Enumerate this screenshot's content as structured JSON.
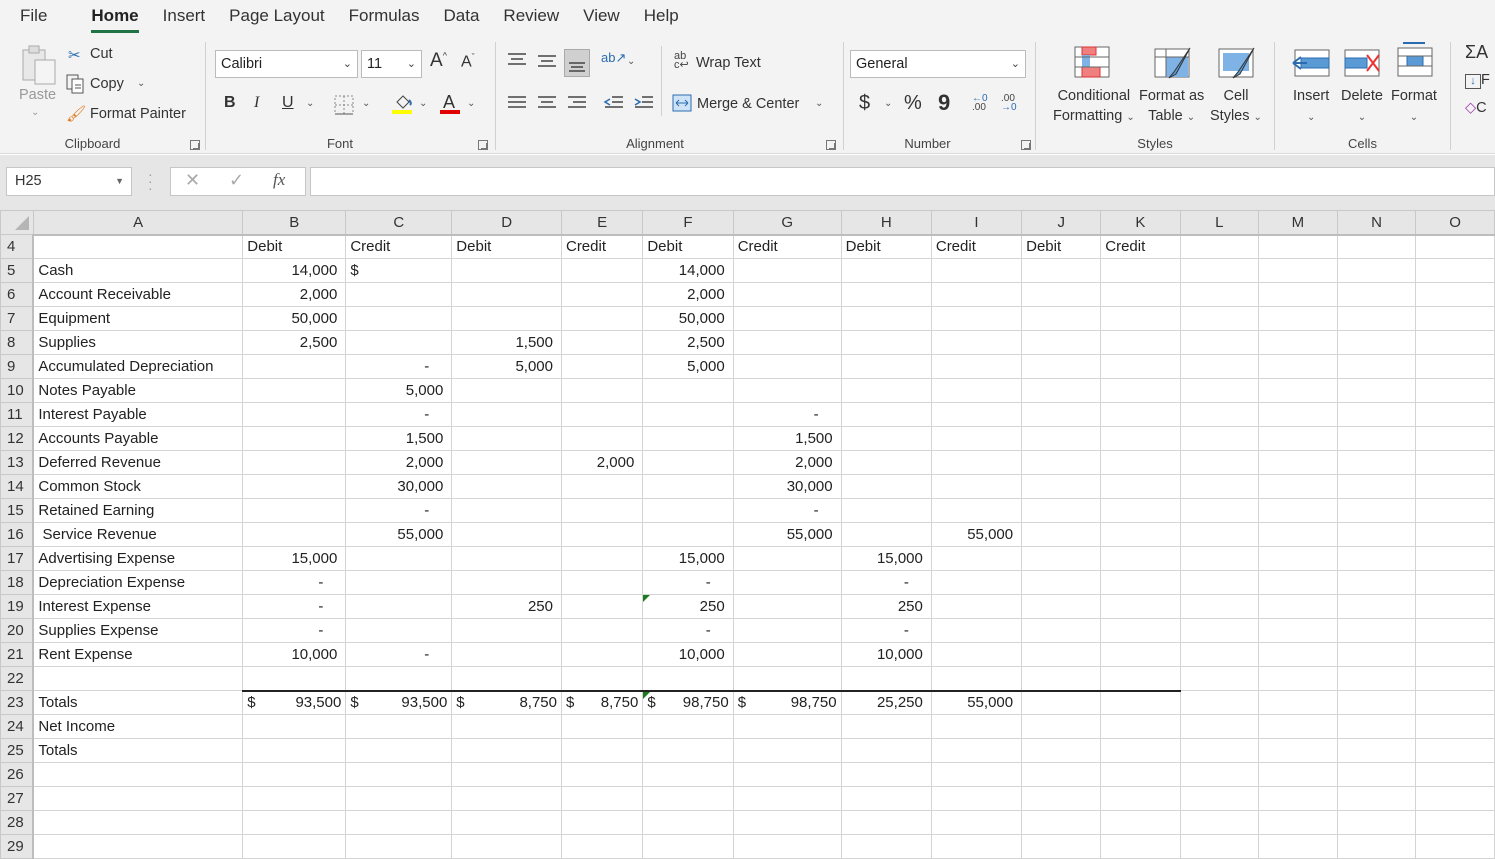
{
  "menu": [
    "File",
    "Home",
    "Insert",
    "Page Layout",
    "Formulas",
    "Data",
    "Review",
    "View",
    "Help"
  ],
  "active_menu": "Home",
  "ribbon": {
    "clipboard": {
      "label": "Clipboard",
      "paste": "Paste",
      "cut": "Cut",
      "copy": "Copy",
      "format_painter": "Format Painter"
    },
    "font": {
      "label": "Font",
      "font_name": "Calibri",
      "font_size": "11",
      "bold": "B",
      "italic": "I",
      "underline": "U",
      "highlight_color": "#ffff00",
      "font_color": "#ff0000"
    },
    "alignment": {
      "label": "Alignment",
      "wrap_text": "Wrap Text",
      "merge_center": "Merge & Center"
    },
    "number": {
      "label": "Number",
      "format": "General",
      "currency": "$",
      "percent": "%",
      "comma": "9"
    },
    "styles": {
      "label": "Styles",
      "conditional": "Conditional",
      "conditional2": "Formatting",
      "format_as": "Format as",
      "format_as2": "Table",
      "cell": "Cell",
      "cell2": "Styles"
    },
    "cells": {
      "label": "Cells",
      "insert": "Insert",
      "delete": "Delete",
      "format": "Format"
    },
    "editing": {
      "autosum": "A",
      "fill": "F",
      "clear": "C"
    }
  },
  "formula_bar": {
    "name_box": "H25",
    "cancel": "✕",
    "enter": "✓",
    "fx": "fx",
    "value": ""
  },
  "columns": [
    "A",
    "B",
    "C",
    "D",
    "E",
    "F",
    "G",
    "H",
    "I",
    "J",
    "K",
    "L",
    "M",
    "N",
    "O"
  ],
  "rows": [
    {
      "n": "4",
      "cells": [
        "",
        "Debit",
        "Credit",
        "Debit",
        "Credit",
        "Debit",
        "Credit",
        "Debit",
        "Credit",
        "Debit",
        "Credit",
        "",
        "",
        "",
        ""
      ]
    },
    {
      "n": "5",
      "cells": [
        "Cash",
        "14,000",
        "$",
        "",
        "",
        "14,000",
        "",
        "",
        "",
        "",
        "",
        "",
        "",
        "",
        ""
      ]
    },
    {
      "n": "6",
      "cells": [
        "Account Receivable",
        "2,000",
        "",
        "",
        "",
        "2,000",
        "",
        "",
        "",
        "",
        "",
        "",
        "",
        "",
        ""
      ]
    },
    {
      "n": "7",
      "cells": [
        "Equipment",
        "50,000",
        "",
        "",
        "",
        "50,000",
        "",
        "",
        "",
        "",
        "",
        "",
        "",
        "",
        ""
      ]
    },
    {
      "n": "8",
      "cells": [
        "Supplies",
        "2,500",
        "",
        "1,500",
        "",
        "2,500",
        "",
        "",
        "",
        "",
        "",
        "",
        "",
        "",
        ""
      ]
    },
    {
      "n": "9",
      "cells": [
        "Accumulated Depreciation",
        "",
        "-",
        "5,000",
        "",
        "5,000",
        "",
        "",
        "",
        "",
        "",
        "",
        "",
        "",
        ""
      ]
    },
    {
      "n": "10",
      "cells": [
        "Notes Payable",
        "",
        "5,000",
        "",
        "",
        "",
        "",
        "",
        "",
        "",
        "",
        "",
        "",
        "",
        ""
      ]
    },
    {
      "n": "11",
      "cells": [
        "Interest Payable",
        "",
        "-",
        "",
        "",
        "",
        "-",
        "",
        "",
        "",
        "",
        "",
        "",
        "",
        ""
      ]
    },
    {
      "n": "12",
      "cells": [
        "Accounts Payable",
        "",
        "1,500",
        "",
        "",
        "",
        "1,500",
        "",
        "",
        "",
        "",
        "",
        "",
        "",
        ""
      ]
    },
    {
      "n": "13",
      "cells": [
        "Deferred Revenue",
        "",
        "2,000",
        "",
        "2,000",
        "",
        "2,000",
        "",
        "",
        "",
        "",
        "",
        "",
        "",
        ""
      ]
    },
    {
      "n": "14",
      "cells": [
        "Common Stock",
        "",
        "30,000",
        "",
        "",
        "",
        "30,000",
        "",
        "",
        "",
        "",
        "",
        "",
        "",
        ""
      ]
    },
    {
      "n": "15",
      "cells": [
        "Retained Earning",
        "",
        "-",
        "",
        "",
        "",
        "-",
        "",
        "",
        "",
        "",
        "",
        "",
        "",
        ""
      ]
    },
    {
      "n": "16",
      "cells": [
        " Service Revenue",
        "",
        "55,000",
        "",
        "",
        "",
        "55,000",
        "",
        "55,000",
        "",
        "",
        "",
        "",
        "",
        ""
      ]
    },
    {
      "n": "17",
      "cells": [
        "Advertising Expense",
        "15,000",
        "",
        "",
        "",
        "15,000",
        "",
        "15,000",
        "",
        "",
        "",
        "",
        "",
        "",
        ""
      ]
    },
    {
      "n": "18",
      "cells": [
        "Depreciation Expense",
        "-",
        "",
        "",
        "",
        "-",
        "",
        "-",
        "",
        "",
        "",
        "",
        "",
        "",
        ""
      ]
    },
    {
      "n": "19",
      "cells": [
        "Interest Expense",
        "-",
        "",
        "250",
        "",
        "250",
        "",
        "250",
        "",
        "",
        "",
        "",
        "",
        "",
        ""
      ]
    },
    {
      "n": "20",
      "cells": [
        "Supplies Expense",
        "-",
        "",
        "",
        "",
        "-",
        "",
        "-",
        "",
        "",
        "",
        "",
        "",
        "",
        ""
      ]
    },
    {
      "n": "21",
      "cells": [
        "Rent Expense",
        "10,000",
        "-",
        "",
        "",
        "10,000",
        "",
        "10,000",
        "",
        "",
        "",
        "",
        "",
        "",
        ""
      ]
    },
    {
      "n": "22",
      "cells": [
        "",
        "",
        "",
        "",
        "",
        "",
        "",
        "",
        "",
        "",
        "",
        "",
        "",
        "",
        ""
      ]
    },
    {
      "n": "23",
      "cells": [
        "Totals",
        "$|93,500",
        "$|93,500",
        "$|8,750",
        "$|8,750",
        "$|98,750",
        "$|98,750",
        "25,250",
        "55,000",
        "",
        "",
        "",
        "",
        "",
        ""
      ]
    },
    {
      "n": "24",
      "cells": [
        "Net Income",
        "",
        "",
        "",
        "",
        "",
        "",
        "",
        "",
        "",
        "",
        "",
        "",
        "",
        ""
      ]
    },
    {
      "n": "25",
      "cells": [
        "Totals",
        "",
        "",
        "",
        "",
        "",
        "",
        "",
        "",
        "",
        "",
        "",
        "",
        "",
        ""
      ]
    },
    {
      "n": "26",
      "cells": [
        "",
        "",
        "",
        "",
        "",
        "",
        "",
        "",
        "",
        "",
        "",
        "",
        "",
        "",
        ""
      ]
    },
    {
      "n": "27",
      "cells": [
        "",
        "",
        "",
        "",
        "",
        "",
        "",
        "",
        "",
        "",
        "",
        "",
        "",
        "",
        ""
      ]
    },
    {
      "n": "28",
      "cells": [
        "",
        "",
        "",
        "",
        "",
        "",
        "",
        "",
        "",
        "",
        "",
        "",
        "",
        "",
        ""
      ]
    },
    {
      "n": "29",
      "cells": [
        "",
        "",
        "",
        "",
        "",
        "",
        "",
        "",
        "",
        "",
        "",
        "",
        "",
        "",
        ""
      ]
    }
  ]
}
